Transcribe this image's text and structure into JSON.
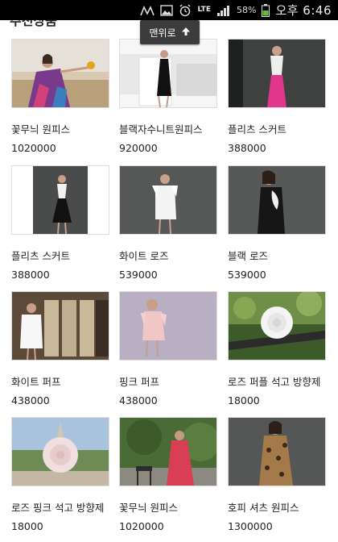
{
  "status_bar": {
    "battery_percent": "58%",
    "network": "LTE",
    "time": "오후 6:46",
    "icons": [
      "signal-muted-icon",
      "image-icon",
      "alarm-icon",
      "lte-icon",
      "signal-icon",
      "battery-icon"
    ]
  },
  "section_title": "추천상품",
  "to_top_label": "맨위로",
  "products": [
    {
      "name": "꽃무늬 원피스",
      "price": "1020000"
    },
    {
      "name": "블랙자수니트원피스",
      "price": "920000"
    },
    {
      "name": "플리츠 스커트",
      "price": "388000"
    },
    {
      "name": "플리츠 스커트",
      "price": "388000"
    },
    {
      "name": "화이트 로즈",
      "price": "539000"
    },
    {
      "name": "블랙 로즈",
      "price": "539000"
    },
    {
      "name": "화이트 퍼프",
      "price": "438000"
    },
    {
      "name": "핑크 퍼프",
      "price": "438000"
    },
    {
      "name": "로즈 퍼플 석고 방향제",
      "price": "18000"
    },
    {
      "name": "로즈 핑크 석고 방향제",
      "price": "18000"
    },
    {
      "name": "꽃무늬 원피스",
      "price": "1020000"
    },
    {
      "name": "호피 셔츠 원피스",
      "price": "1300000"
    }
  ]
}
